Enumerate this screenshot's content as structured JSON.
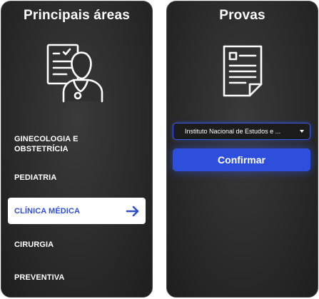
{
  "areas_card": {
    "title": "Principais áreas",
    "icon": "doctor-with-clipboard-icon",
    "items": [
      {
        "label": "GINECOLOGIA E\nOBSTETRÍCIA",
        "selected": false
      },
      {
        "label": "PEDIATRIA",
        "selected": false
      },
      {
        "label": "CLÍNICA MÉDICA",
        "selected": true,
        "icon": "arrow-right-icon"
      },
      {
        "label": "CIRURGIA",
        "selected": false
      },
      {
        "label": "PREVENTIVA",
        "selected": false
      }
    ]
  },
  "exams_card": {
    "title": "Provas",
    "icon": "document-icon",
    "select": {
      "value": "Instituto Nacional de Estudos e ...",
      "icon": "chevron-down-icon"
    },
    "confirm_label": "Confirmar"
  },
  "colors": {
    "card_background": "#2b2b2b",
    "accent_blue": "#2e4fdc",
    "selected_text": "#2f4ed4",
    "text": "#ffffff"
  }
}
